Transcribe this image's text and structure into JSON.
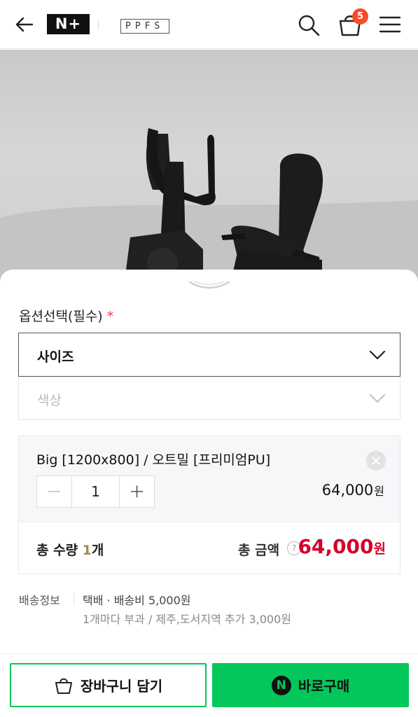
{
  "header": {
    "brand_logo": "N+",
    "store_logo": "PPFS",
    "cart_count": "5",
    "badge_color": "#fa4b28"
  },
  "sheet": {
    "option_title": "옵션선택(필수)",
    "required_mark": "*",
    "size_select": {
      "label": "사이즈"
    },
    "color_select": {
      "label": "색상"
    },
    "selected_option": {
      "name": "Big [1200x800] / 오트밀 [프리미엄PU]",
      "quantity": "1",
      "price": "64,000",
      "currency": "원"
    },
    "total": {
      "qty_prefix": "총 수량 ",
      "qty_value": "1",
      "qty_suffix": "개",
      "amount_label": "총 금액",
      "help": "?",
      "amount": "64,000",
      "currency": "원"
    },
    "shipping": {
      "label": "배송정보",
      "main": "택배 · 배송비 5,000원",
      "sub": "1개마다 부과 / 제주,도서지역 추가 3,000원"
    }
  },
  "footer": {
    "cart_button": "장바구니 담기",
    "buy_button": "바로구매",
    "npay_mark": "N",
    "accent_color": "#03c75a"
  }
}
